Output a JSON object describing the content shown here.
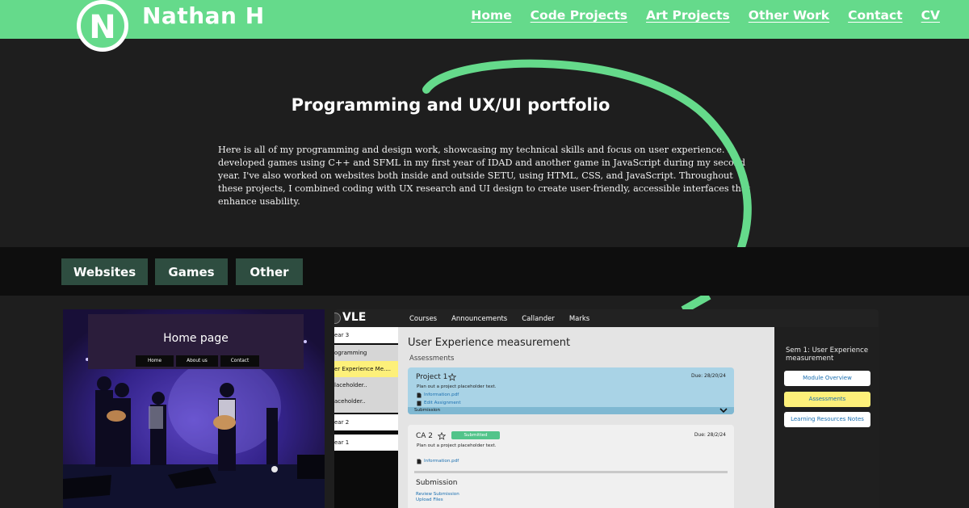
{
  "header": {
    "logo_letter": "N",
    "brand": "Nathan H",
    "nav": [
      "Home",
      "Code Projects",
      "Art Projects",
      "Other Work",
      "Contact",
      "CV"
    ]
  },
  "hero": {
    "title": "Programming and UX/UI portfolio",
    "text": "Here is all of my programming and design work, showcasing my technical skills and focus on user experience. I developed games using C++ and SFML in my first year of IDAD and another game in JavaScript during my second year. I've also worked on websites both inside and outside SETU, using HTML, CSS, and JavaScript. Throughout these projects, I combined coding with UX research and UI design to create user-friendly, accessible interfaces that enhance usability."
  },
  "filters": [
    "Websites",
    "Games",
    "Other"
  ],
  "card_home": {
    "title": "Home page",
    "nav": [
      "Home",
      "About us",
      "Contact"
    ]
  },
  "card_vle": {
    "logo": "VLE",
    "menu": [
      "Courses",
      "Announcements",
      "Callander",
      "Marks"
    ],
    "sidebar": [
      "ear 3",
      "ogramming",
      "er Experience Me....",
      "laceholder..",
      "aceholder..",
      "ear 2",
      "ear 1"
    ],
    "title": "User Experience measurement",
    "subtitle": "Assessments",
    "project1": {
      "name": "Project 1",
      "due": "Due: 28/20/24",
      "desc": "Plan out a project placeholder text.",
      "link1": "Information.pdf",
      "link2": "Edit Assignment",
      "submission": "Submission"
    },
    "ca2": {
      "name": "CA 2",
      "badge": "Submitted",
      "due": "Due: 28/2/24",
      "desc": "Plan out a project placeholder text.",
      "link": "Information.pdf",
      "submission_title": "Submission",
      "review": "Review Submission",
      "upload": "Upload Files"
    },
    "right_title": "Sem 1: User Experience measurement",
    "right_buttons": [
      "Module Overview",
      "Assessments",
      "Learning Resources Notes"
    ]
  },
  "colors": {
    "brand_green": "#65da8b",
    "filter_bg": "#2e4d40",
    "dark_bg": "#1e1e1e",
    "highlight_yellow": "#fdf07a"
  }
}
